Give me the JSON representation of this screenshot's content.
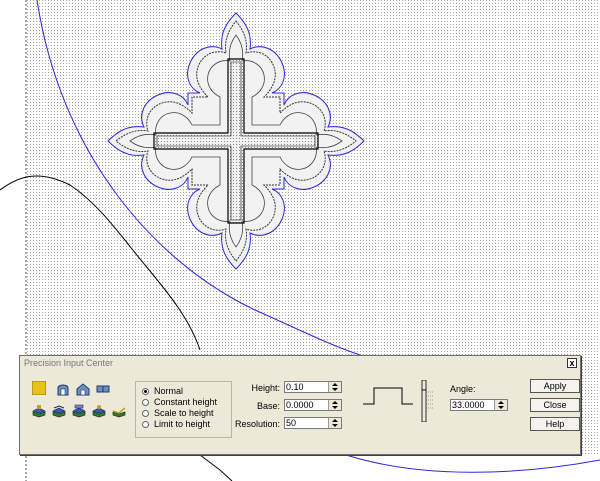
{
  "dialog": {
    "title": "Precision Input Center",
    "close_label": "x",
    "toolbar_icons": [
      "color-swatch-icon",
      "arch-shape-icon",
      "house-shape-icon",
      "bar-shape-icon",
      "layer-stack-icon-1",
      "layer-stack-icon-2",
      "layer-stack-icon-3",
      "layer-stack-icon-4",
      "layer-stack-icon-5"
    ],
    "mode_options": [
      {
        "label": "Normal",
        "selected": true
      },
      {
        "label": "Constant height",
        "selected": false
      },
      {
        "label": "Scale to height",
        "selected": false
      },
      {
        "label": "Limit to height",
        "selected": false
      }
    ],
    "height": {
      "label": "Height:",
      "value": "0.10"
    },
    "base": {
      "label": "Base:",
      "value": "0.0000"
    },
    "resolution": {
      "label": "Resolution:",
      "value": "50"
    },
    "angle": {
      "label": "Angle:",
      "value": "33.0000"
    },
    "buttons": {
      "apply": "Apply",
      "close": "Close",
      "help": "Help"
    }
  },
  "colors": {
    "swatch": "#e8c21c",
    "outline_blue": "#2a2ad8",
    "dialog_bg": "#ece9d8"
  }
}
